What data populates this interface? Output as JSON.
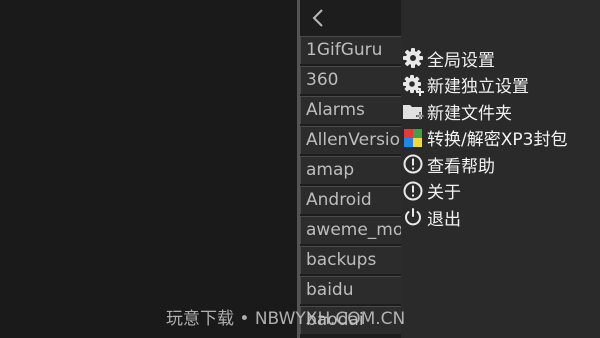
{
  "file_browser": {
    "back_icon": "chevron-left-icon",
    "folders": [
      {
        "label": "1GifGuru"
      },
      {
        "label": "360"
      },
      {
        "label": "Alarms"
      },
      {
        "label": "AllenVersion"
      },
      {
        "label": "amap"
      },
      {
        "label": "Android"
      },
      {
        "label": "aweme_monitor"
      },
      {
        "label": "backups"
      },
      {
        "label": "baidu"
      },
      {
        "label": "baodai"
      }
    ]
  },
  "menu": {
    "items": [
      {
        "label": "全局设置",
        "icon": "gear-icon"
      },
      {
        "label": "新建独立设置",
        "icon": "gear-plus-icon"
      },
      {
        "label": "新建文件夹",
        "icon": "new-folder-icon"
      },
      {
        "label": "转换/解密XP3封包",
        "icon": "color-grid-icon"
      },
      {
        "label": "查看帮助",
        "icon": "exclamation-icon"
      },
      {
        "label": "关于",
        "icon": "exclamation-icon"
      },
      {
        "label": "退出",
        "icon": "power-icon"
      }
    ]
  },
  "watermark": {
    "text": "玩意下载 • NBWYXH.COM.CN"
  },
  "colors": {
    "background": "#1a1a1a",
    "panel": "#2a2a2a",
    "folder_item": "#2c2c2c",
    "menu_text": "#f2f2f2"
  }
}
